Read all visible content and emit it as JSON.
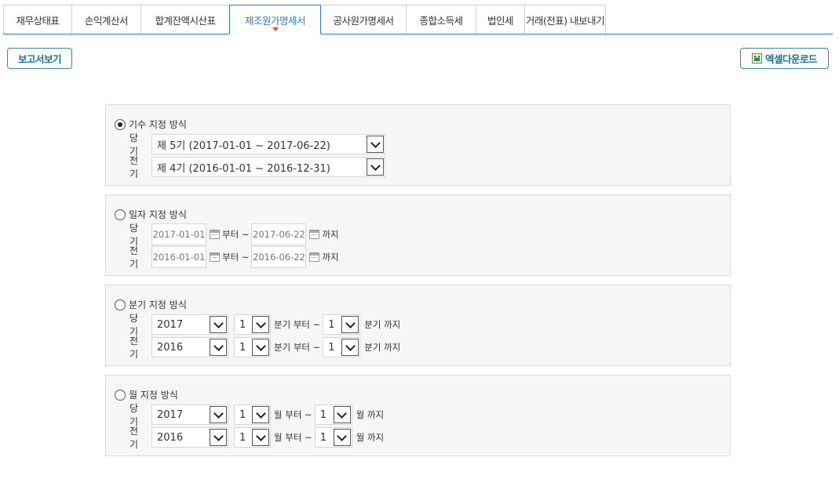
{
  "tabs": [
    {
      "label": "재무상태표",
      "active": false
    },
    {
      "label": "손익계산서",
      "active": false
    },
    {
      "label": "합계잔액시산표",
      "active": false
    },
    {
      "label": "제조원가명세서",
      "active": true
    },
    {
      "label": "공사원가명세서",
      "active": false
    },
    {
      "label": "종합소득세",
      "active": false
    },
    {
      "label": "법인세",
      "active": false
    },
    {
      "label": "거래(전표) 내보내기",
      "active": false
    }
  ],
  "toolbar": {
    "report_label": "보고서보기",
    "excel_label": "엑셀다운로드",
    "excel_icon": "excel-icon"
  },
  "fiscal_mode": {
    "title": "기수 지정 방식",
    "selected": true,
    "current_label": "당 기",
    "current_value": "제 5기 (2017-01-01 ~ 2017-06-22)",
    "prior_label": "전 기",
    "prior_value": "제 4기 (2016-01-01 ~ 2016-12-31)"
  },
  "date_mode": {
    "title": "일자 지정 방식",
    "selected": false,
    "current_label": "당 기",
    "current_from": "2017-01-01",
    "current_to": "2017-06-22",
    "prior_label": "전 기",
    "prior_from": "2016-01-01",
    "prior_to": "2016-06-22",
    "from_text": "부터 ~",
    "to_text": "까지"
  },
  "quarter_mode": {
    "title": "분기 지정 방식",
    "selected": false,
    "current_label": "당 기",
    "current_year": "2017",
    "current_from": "1",
    "current_to": "1",
    "prior_label": "전 기",
    "prior_year": "2016",
    "prior_from": "1",
    "prior_to": "1",
    "from_text": "분기 부터 ~",
    "to_text": "분기 까지"
  },
  "month_mode": {
    "title": "월 지정 방식",
    "selected": false,
    "current_label": "당 기",
    "current_year": "2017",
    "current_from": "1",
    "current_to": "1",
    "prior_label": "전 기",
    "prior_year": "2016",
    "prior_from": "1",
    "prior_to": "1",
    "from_text": "월 부터 ~",
    "to_text": "월 까지"
  },
  "colors": {
    "accent": "#2f7ac8",
    "button_border": "#3a86a0",
    "active_caret": "#e0443a",
    "panel_bg": "#f6f6f6"
  }
}
